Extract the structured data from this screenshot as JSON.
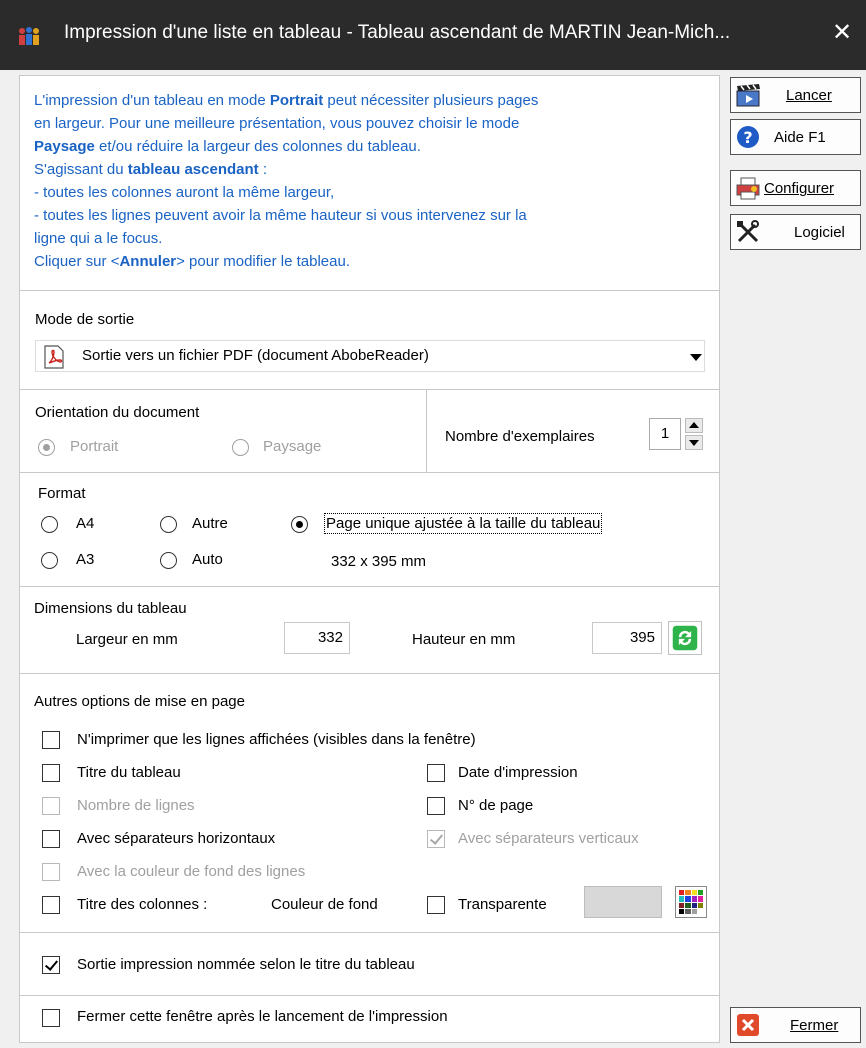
{
  "window": {
    "title": "Impression d'une liste en tableau - Tableau ascendant de  MARTIN Jean-Mich...",
    "close_glyph": "✕"
  },
  "info": {
    "lines": [
      [
        {
          "t": "L'impression d'un tableau en mode "
        },
        {
          "t": "Portrait",
          "b": true
        },
        {
          "t": " peut nécessiter plusieurs pages"
        }
      ],
      [
        {
          "t": "en largeur. Pour une meilleure présentation, vous pouvez choisir le mode"
        }
      ],
      [
        {
          "t": "Paysage",
          "b": true
        },
        {
          "t": " et/ou réduire la largeur des colonnes du tableau."
        }
      ],
      [
        {
          "t": "S'agissant du "
        },
        {
          "t": "tableau ascendant",
          "b": true
        },
        {
          "t": " :"
        }
      ],
      [
        {
          "t": "- toutes les colonnes auront la même largeur,"
        }
      ],
      [
        {
          "t": "- toutes les lignes peuvent avoir la même hauteur si vous intervenez sur la"
        }
      ],
      [
        {
          "t": "ligne qui a le focus."
        }
      ],
      [
        {
          "t": "Cliquer sur <"
        },
        {
          "t": "Annuler",
          "b": true
        },
        {
          "t": "> pour modifier le tableau."
        }
      ]
    ]
  },
  "mode": {
    "label": "Mode de sortie",
    "selected": "Sortie vers un fichier PDF (document AbobeReader)"
  },
  "orientation": {
    "label": "Orientation du document",
    "portrait": "Portrait",
    "paysage": "Paysage",
    "selected": "portrait"
  },
  "copies": {
    "label": "Nombre d'exemplaires",
    "value": "1"
  },
  "format": {
    "label": "Format",
    "a4": "A4",
    "a3": "A3",
    "autre": "Autre",
    "auto": "Auto",
    "page_unique": "Page unique ajustée à la taille du tableau",
    "size": "332 x 395  mm",
    "selected": "page_unique"
  },
  "dimensions": {
    "label": "Dimensions du tableau",
    "largeur_label": "Largeur en mm",
    "largeur": "332",
    "hauteur_label": "Hauteur en mm",
    "hauteur": "395"
  },
  "options": {
    "label": "Autres options de mise en page",
    "lignes_affichees": "N'imprimer que les lignes affichées (visibles dans la fenêtre)",
    "titre_tableau": "Titre du tableau",
    "date_impression": "Date d'impression",
    "nombre_lignes": "Nombre de lignes",
    "num_page": "N° de page",
    "sep_horizontaux": "Avec séparateurs horizontaux",
    "sep_verticaux": "Avec séparateurs verticaux",
    "couleur_fond_lignes": "Avec la couleur de fond des lignes",
    "titre_colonnes": "Titre des colonnes :",
    "couleur_fond": "Couleur de fond",
    "transparente": "Transparente"
  },
  "output": {
    "nommee": "Sortie impression nommée selon le titre du tableau",
    "fermer_apres": "Fermer cette fenêtre après le lancement de l'impression"
  },
  "buttons": {
    "lancer": "Lancer",
    "aide": "Aide  F1",
    "configurer": "Configurer",
    "logiciel": "Logiciel",
    "fermer": "Fermer"
  },
  "colors": {
    "info_text": "#1a63c4",
    "titlebar": "#2b2b2b",
    "refresh_green": "#2fb44b",
    "help_blue": "#1e5bc6",
    "close_red": "#e04a2a"
  }
}
